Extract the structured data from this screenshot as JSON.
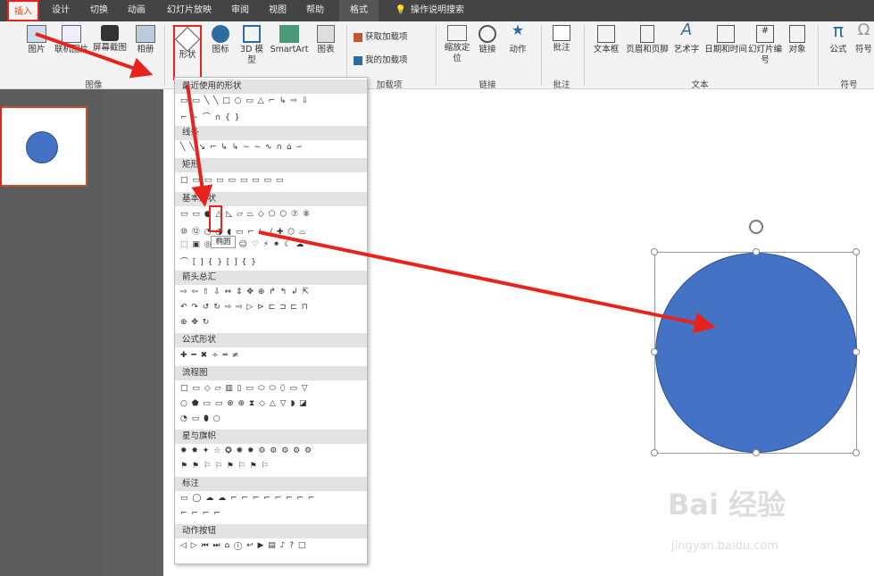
{
  "tabs": [
    "插入",
    "设计",
    "切换",
    "动画",
    "幻灯片放映",
    "审阅",
    "视图",
    "帮助",
    "格式",
    "操作说明搜索"
  ],
  "ribbon": {
    "buttons": [
      "图片",
      "联机图片",
      "屏幕截图",
      "相册",
      "形状",
      "图标",
      "3D 模型",
      "SmartArt",
      "图表",
      "获取加载项",
      "我的加载项",
      "缩放定位",
      "链接",
      "动作",
      "批注",
      "文本框",
      "页眉和页脚",
      "艺术字",
      "日期和时间",
      "幻灯片编号",
      "对象",
      "公式",
      "符号"
    ],
    "groups": [
      "图像",
      "加载项",
      "链接",
      "批注",
      "文本",
      "符号"
    ]
  },
  "menu": {
    "sections": [
      "最近使用的形状",
      "线条",
      "矩形",
      "基本形状",
      "箭头总汇",
      "公式形状",
      "流程图",
      "星与旗帜",
      "标注",
      "动作按钮"
    ],
    "tooltip": "椭圆"
  },
  "watermark": {
    "brand": "Bai 经验",
    "url": "jingyan.baidu.com"
  },
  "colors": {
    "shape_fill": "#4472c4",
    "highlight": "#e8231c",
    "accent": "#c5532e"
  }
}
